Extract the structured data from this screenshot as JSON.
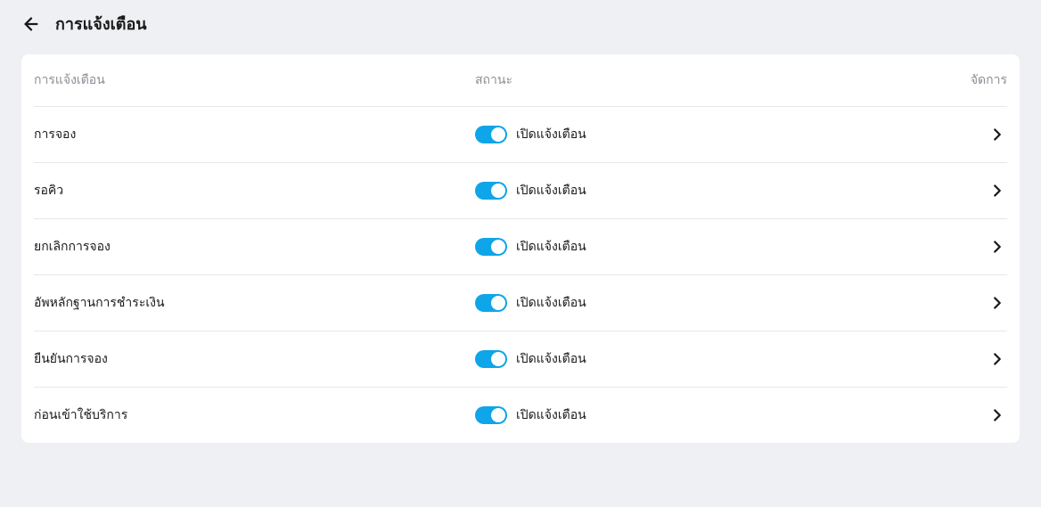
{
  "header": {
    "title": "การแจ้งเตือน"
  },
  "table": {
    "columns": {
      "name": "การแจ้งเตือน",
      "status": "สถานะ",
      "action": "จัดการ"
    },
    "status_on_label": "เปิดแจ้งเตือน",
    "rows": [
      {
        "name": "การจอง"
      },
      {
        "name": "รอคิว"
      },
      {
        "name": "ยกเลิกการจอง"
      },
      {
        "name": "อัพหลักฐานการชำระเงิน"
      },
      {
        "name": "ยืนยันการจอง"
      },
      {
        "name": "ก่อนเข้าใช้บริการ"
      }
    ]
  }
}
